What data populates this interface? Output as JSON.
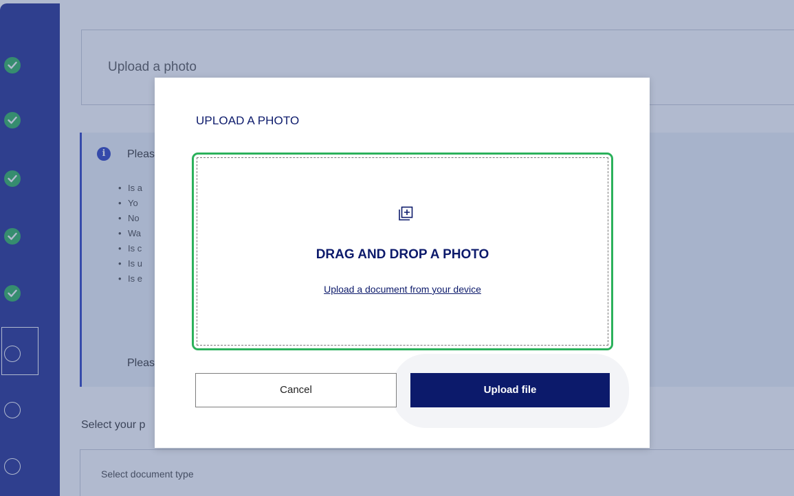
{
  "background": {
    "card_title": "Upload a photo",
    "info_heading": "Pleas",
    "info_items": [
      "Is a",
      "Yo",
      "No",
      "Wa",
      "Is c",
      "Is u",
      "Is e"
    ],
    "info_footer": "Pleas",
    "select_label": "Select your p",
    "select_placeholder": "Select document type",
    "steps": [
      "done",
      "done",
      "done",
      "done",
      "done",
      "todo",
      "todo",
      "todo"
    ]
  },
  "modal": {
    "title": "UPLOAD A PHOTO",
    "dropzone": {
      "icon": "add-photo-icon",
      "title": "DRAG AND DROP A PHOTO",
      "link": "Upload a document from your device"
    },
    "cancel_label": "Cancel",
    "upload_label": "Upload file"
  },
  "colors": {
    "brand_navy": "#0c1a6b",
    "success_green": "#2bb15b",
    "sidebar_blue": "#1f2b8f"
  }
}
